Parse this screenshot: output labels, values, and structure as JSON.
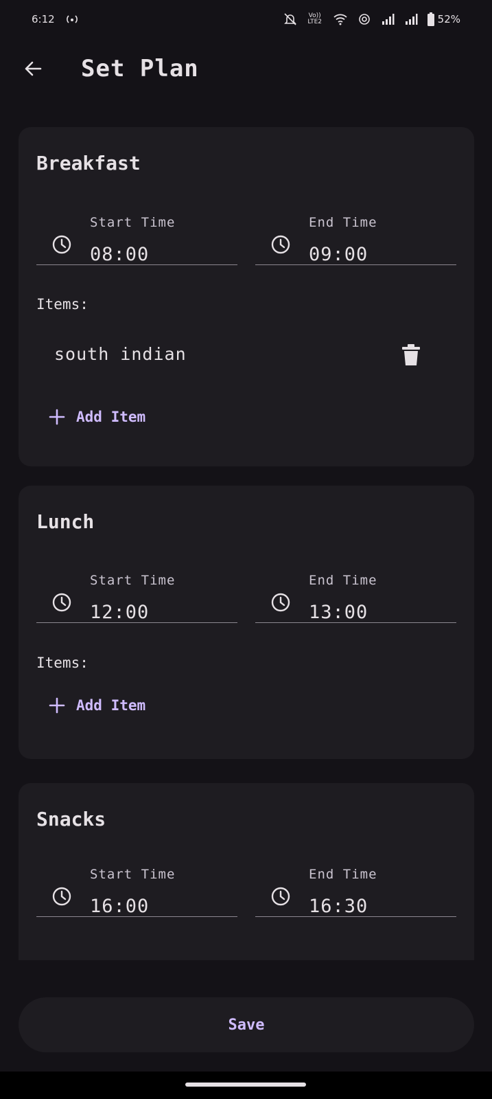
{
  "status_bar": {
    "time": "6:12",
    "battery": "52%",
    "icons": [
      "hotspot-icon",
      "silent-icon",
      "volte-icon",
      "wifi-icon",
      "nfc-icon",
      "signal-icon",
      "signal-icon",
      "battery-icon"
    ],
    "volte_text": "Vo)) LTE2"
  },
  "header": {
    "title": "Set Plan"
  },
  "meals": [
    {
      "title": "Breakfast",
      "start_label": "Start Time",
      "start_value": "08:00",
      "end_label": "End Time",
      "end_value": "09:00",
      "items_label": "Items:",
      "items": [
        "south indian"
      ],
      "add_item_label": "Add Item"
    },
    {
      "title": "Lunch",
      "start_label": "Start Time",
      "start_value": "12:00",
      "end_label": "End Time",
      "end_value": "13:00",
      "items_label": "Items:",
      "items": [],
      "add_item_label": "Add Item"
    },
    {
      "title": "Snacks",
      "start_label": "Start Time",
      "start_value": "16:00",
      "end_label": "End Time",
      "end_value": "16:30"
    }
  ],
  "save": {
    "label": "Save"
  },
  "colors": {
    "background": "#141217",
    "card": "#1E1C21",
    "accent": "#D0BCFF",
    "text": "#E6E1E5"
  }
}
